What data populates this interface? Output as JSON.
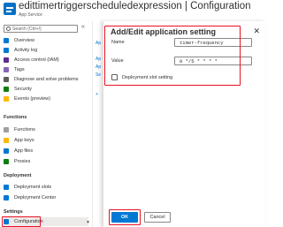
{
  "header": {
    "title": "edittimertriggerscheduledexpression | Configuration",
    "subtitle": "App Service"
  },
  "sidebar": {
    "search_placeholder": "Search (Ctrl+/)",
    "collapse_glyph": "«",
    "items": [
      {
        "label": "Overview",
        "icon": "overview-icon",
        "color": "#0078d4"
      },
      {
        "label": "Activity log",
        "icon": "activity-log-icon",
        "color": "#0078d4"
      },
      {
        "label": "Access control (IAM)",
        "icon": "iam-icon",
        "color": "#5c2d91"
      },
      {
        "label": "Tags",
        "icon": "tag-icon",
        "color": "#8764b8"
      },
      {
        "label": "Diagnose and solve problems",
        "icon": "diagnose-icon",
        "color": "#605e5c"
      },
      {
        "label": "Security",
        "icon": "security-icon",
        "color": "#107c10"
      },
      {
        "label": "Events (preview)",
        "icon": "events-icon",
        "color": "#ffb900"
      }
    ],
    "sections": [
      {
        "header": "Functions",
        "items": [
          {
            "label": "Functions",
            "icon": "functions-icon",
            "color": "#a19f9d"
          },
          {
            "label": "App keys",
            "icon": "key-icon",
            "color": "#ffb900"
          },
          {
            "label": "App files",
            "icon": "files-icon",
            "color": "#0078d4"
          },
          {
            "label": "Proxies",
            "icon": "proxies-icon",
            "color": "#107c10"
          }
        ]
      },
      {
        "header": "Deployment",
        "items": [
          {
            "label": "Deployment slots",
            "icon": "slots-icon",
            "color": "#0078d4"
          },
          {
            "label": "Deployment Center",
            "icon": "deploy-center-icon",
            "color": "#0078d4"
          }
        ]
      },
      {
        "header": "Settings",
        "items": [
          {
            "label": "Configuration",
            "icon": "configuration-icon",
            "color": "#0078d4"
          }
        ]
      }
    ]
  },
  "middle": {
    "fragments": [
      "Ap",
      "Ap",
      "Ap",
      "Se",
      "+"
    ]
  },
  "dialog": {
    "title": "Add/Edit application setting",
    "close_glyph": "✕",
    "name_label": "Name",
    "name_value": "timer-frequency",
    "value_label": "Value",
    "value_value": "0 */5 * * * *",
    "slot_label": "Deployment slot setting",
    "ok_label": "OK",
    "cancel_label": "Cancel"
  },
  "colors": {
    "accent": "#0078d4",
    "highlight": "#e81123"
  }
}
